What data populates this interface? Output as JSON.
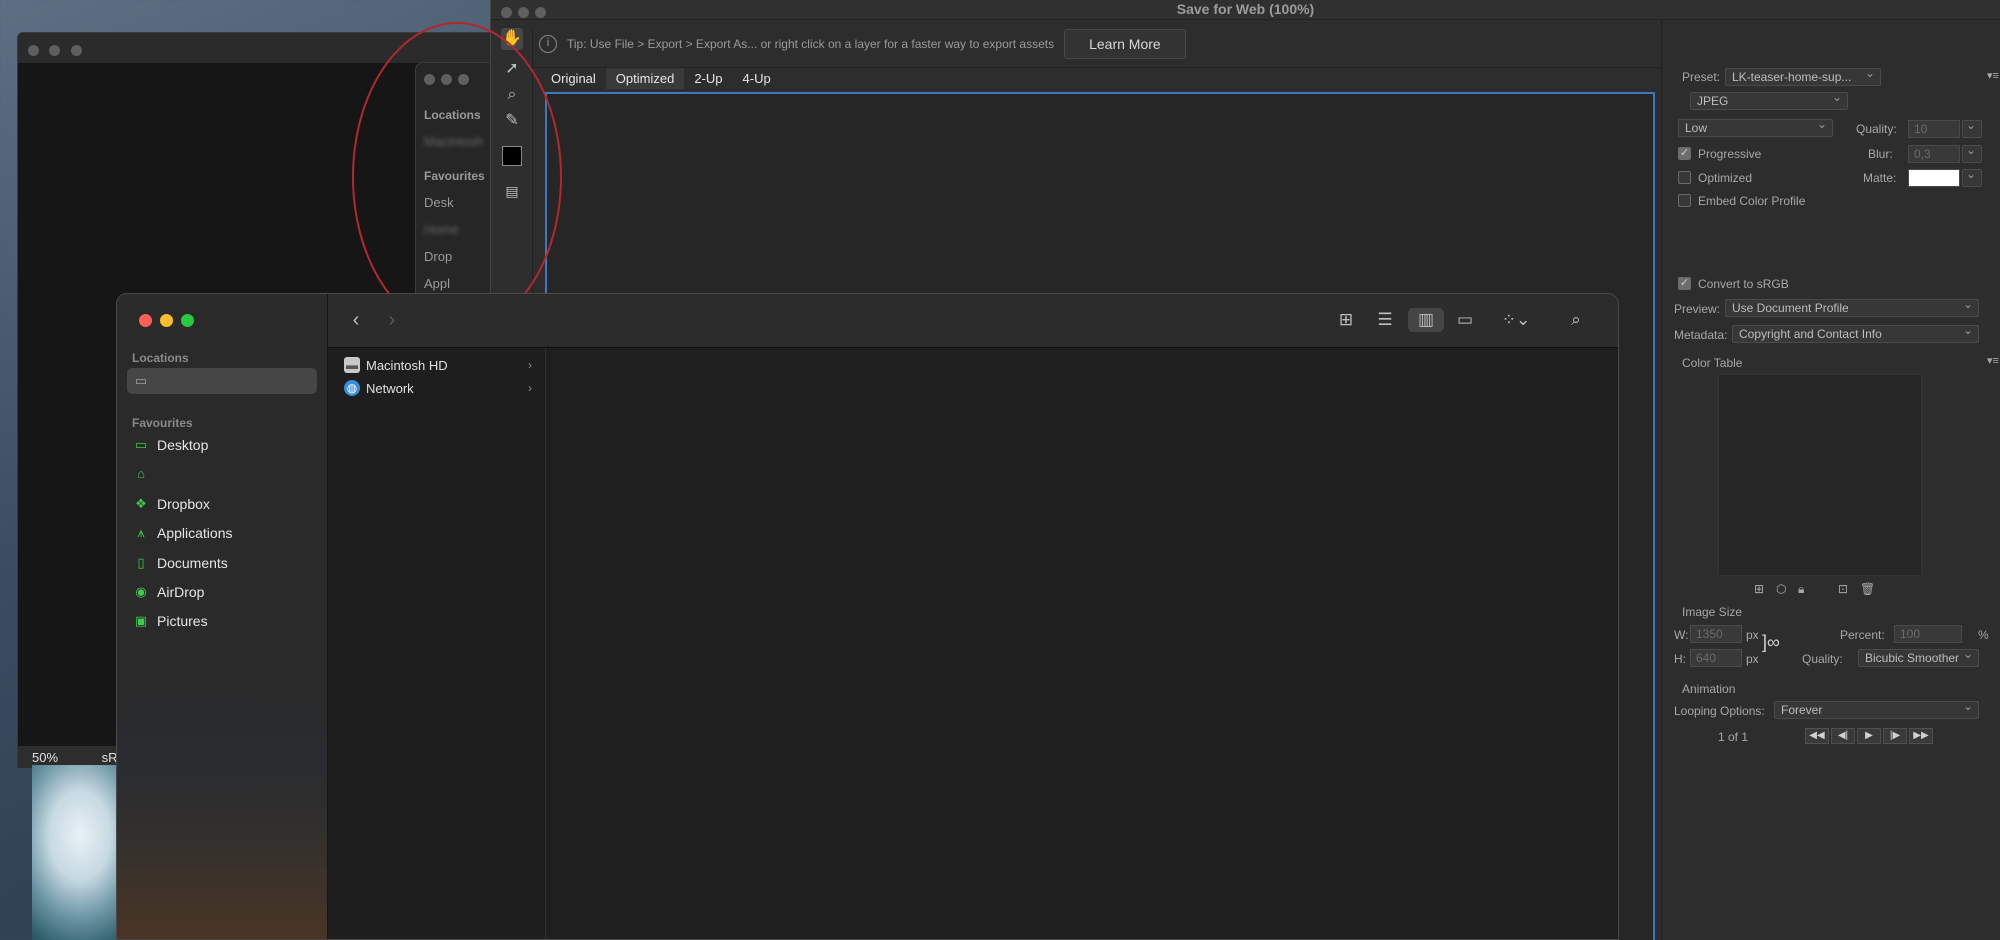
{
  "ps_document": {
    "zoom": "50%",
    "profile": "sR"
  },
  "middle_finder": {
    "locations_label": "Locations",
    "location_item": "Macintosh",
    "favourites_label": "Favourites",
    "items": [
      "Desk",
      "Home",
      "Drop",
      "Appl"
    ]
  },
  "save_for_web": {
    "title": "Save for Web (100%)",
    "tip": "Tip: Use File > Export > Export As...  or right click on a layer for a faster way to export assets",
    "learn_more": "Learn More",
    "tabs": [
      "Original",
      "Optimized",
      "2-Up",
      "4-Up"
    ],
    "active_tab": "Optimized",
    "panel": {
      "preset_label": "Preset:",
      "preset_value": "LK-teaser-home-sup...",
      "format": "JPEG",
      "quality_level": "Low",
      "quality_label": "Quality:",
      "quality_value": "10",
      "progressive_label": "Progressive",
      "progressive_checked": true,
      "blur_label": "Blur:",
      "blur_value": "0,3",
      "optimized_label": "Optimized",
      "optimized_checked": false,
      "matte_label": "Matte:",
      "embed_label": "Embed Color Profile",
      "embed_checked": false,
      "convert_label": "Convert to sRGB",
      "convert_checked": true,
      "preview_label": "Preview:",
      "preview_value": "Use Document Profile",
      "metadata_label": "Metadata:",
      "metadata_value": "Copyright and Contact Info",
      "color_table_label": "Color Table",
      "image_size_label": "Image Size",
      "w_label": "W:",
      "w_value": "1350",
      "h_label": "H:",
      "h_value": "640",
      "px": "px",
      "percent_label": "Percent:",
      "percent_value": "100",
      "percent_unit": "%",
      "resample_label": "Quality:",
      "resample_value": "Bicubic Smoother",
      "animation_label": "Animation",
      "looping_label": "Looping Options:",
      "looping_value": "Forever",
      "frame_counter": "1 of 1"
    }
  },
  "finder": {
    "locations_label": "Locations",
    "favourites_label": "Favourites",
    "favourites": [
      {
        "label": "Desktop",
        "icon": "desktop-icon"
      },
      {
        "label": "",
        "icon": "home-icon"
      },
      {
        "label": "Dropbox",
        "icon": "dropbox-icon"
      },
      {
        "label": "Applications",
        "icon": "applications-icon"
      },
      {
        "label": "Documents",
        "icon": "document-icon"
      },
      {
        "label": "AirDrop",
        "icon": "airdrop-icon"
      },
      {
        "label": "Pictures",
        "icon": "pictures-icon"
      }
    ],
    "column_items": [
      {
        "label": "Macintosh HD",
        "icon": "hard-drive-icon"
      },
      {
        "label": "Network",
        "icon": "network-icon"
      }
    ],
    "colors": {
      "close": "#ff5f57",
      "minimize": "#febc2e",
      "zoom": "#28c840",
      "accent": "#3ec94a"
    }
  }
}
